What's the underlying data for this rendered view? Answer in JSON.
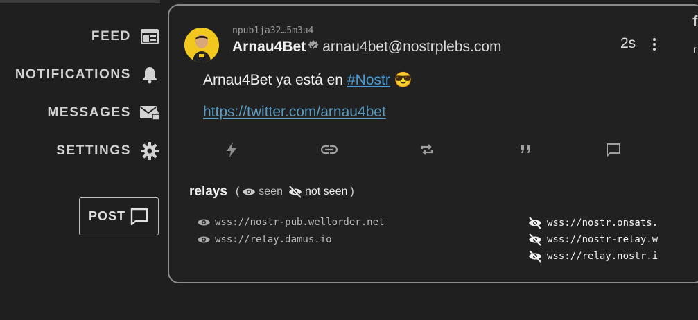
{
  "sidebar": {
    "items": [
      {
        "label": "FEED",
        "icon": "feed-icon"
      },
      {
        "label": "NOTIFICATIONS",
        "icon": "bell-icon"
      },
      {
        "label": "MESSAGES",
        "icon": "envelope-lock-icon"
      },
      {
        "label": "SETTINGS",
        "icon": "gear-icon"
      }
    ],
    "post_label": "POST"
  },
  "note": {
    "npub": "npub1ja32…5m3u4",
    "author_name": "Arnau4Bet",
    "nip05": "arnau4bet@nostrplebs.com",
    "time": "2s",
    "content_prefix": "Arnau4Bet ya está en",
    "hashtag": "#Nostr",
    "emoji": "😎",
    "link": "https://twitter.com/arnau4bet",
    "actions": [
      "zap-icon",
      "link-icon",
      "repost-icon",
      "quote-icon",
      "reply-icon"
    ]
  },
  "relays": {
    "title": "relays",
    "open_paren": "(",
    "close_paren": ")",
    "seen_label": "seen",
    "not_seen_label": "not seen",
    "seen": [
      "wss://nostr-pub.wellorder.net",
      "wss://relay.damus.io"
    ],
    "not_seen": [
      "wss://nostr.onsats.",
      "wss://nostr-relay.w",
      "wss://relay.nostr.i"
    ]
  },
  "edge": {
    "char1": "f",
    "char2": "r"
  },
  "colors": {
    "background": "#1f1f1f",
    "card_border": "#8a8a8a",
    "hashtag": "#4a9bd6",
    "link": "#5b9bc0",
    "avatar": "#f2c81e"
  }
}
